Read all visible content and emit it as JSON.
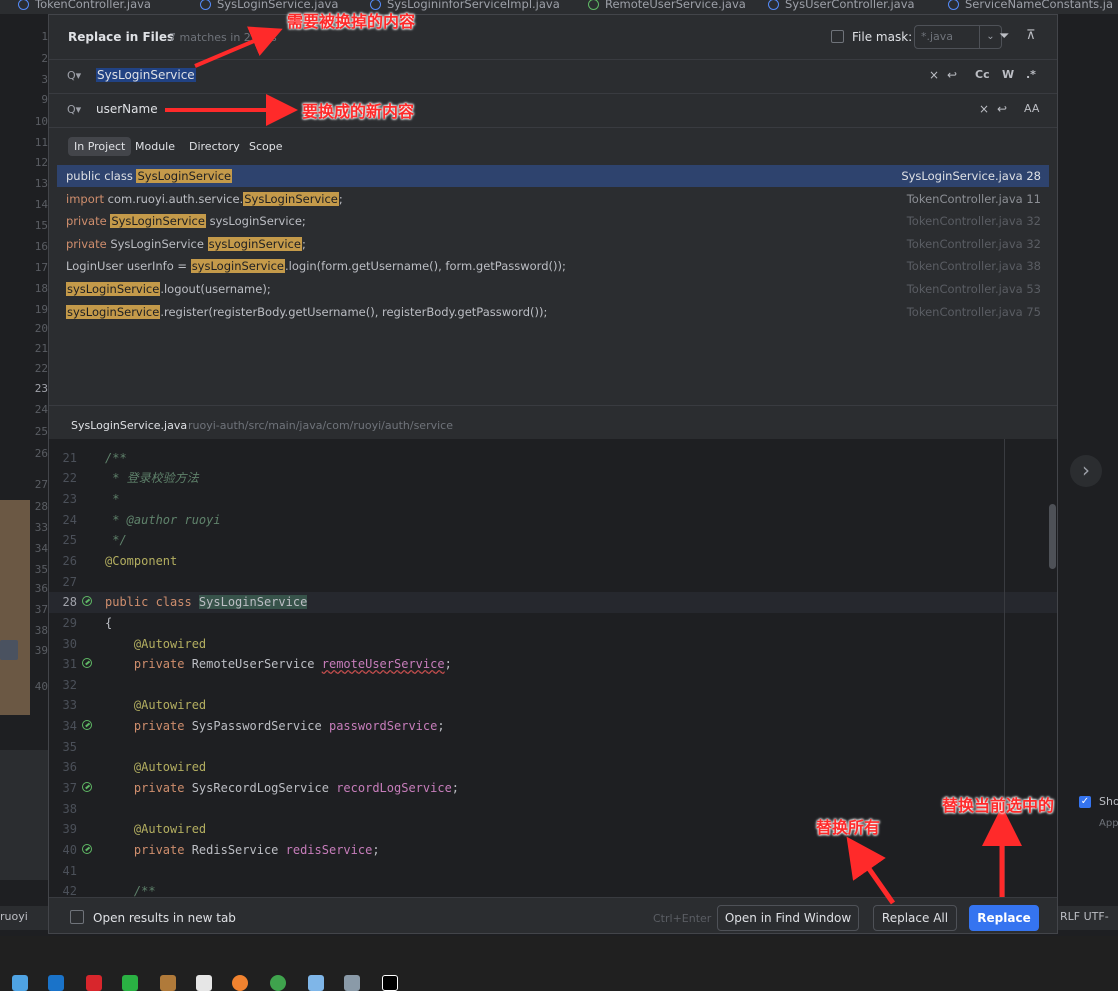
{
  "editor_tabs": [
    {
      "label": "TokenController.java",
      "icon": "class-icon"
    },
    {
      "label": "SysLoginService.java",
      "icon": "class-icon"
    },
    {
      "label": "SysLogininforServiceImpl.java",
      "icon": "class-icon"
    },
    {
      "label": "RemoteUserService.java",
      "icon": "interface-icon"
    },
    {
      "label": "SysUserController.java",
      "icon": "class-icon"
    },
    {
      "label": "ServiceNameConstants.ja",
      "icon": "class-icon"
    }
  ],
  "bg_gutter_lines": [
    "1",
    "2",
    "3",
    "9",
    "10",
    "11",
    "12",
    "13",
    "14",
    "15",
    "16",
    "17",
    "18",
    "19",
    "20",
    "21",
    "22",
    "23",
    "24",
    "25",
    "26",
    "27",
    "28",
    "33",
    "34",
    "35",
    "36",
    "37",
    "38",
    "39",
    "40"
  ],
  "dialog": {
    "title": "Replace in Files",
    "matches": "7 matches in 2 files",
    "file_mask_label": "File mask:",
    "file_mask_value": "*.java",
    "find_value": "SysLoginService",
    "find_options": [
      "Cc",
      "W",
      ".*"
    ],
    "replace_value": "userName",
    "scope_tabs": [
      "In Project",
      "Module",
      "Directory",
      "Scope"
    ],
    "active_scope": "In Project",
    "results": [
      {
        "code": [
          {
            "t": "public class ",
            "k": "kw-plain"
          },
          {
            "t": "SysLoginService",
            "k": "hl"
          }
        ],
        "file": "SysLoginService.java 28",
        "selected": true
      },
      {
        "code": [
          {
            "t": "import ",
            "k": "kw"
          },
          {
            "t": "com.ruoyi.auth.service.",
            "k": ""
          },
          {
            "t": "SysLoginService",
            "k": "hl"
          },
          {
            "t": ";",
            "k": ""
          }
        ],
        "file": "TokenController.java 11"
      },
      {
        "code": [
          {
            "t": "private ",
            "k": "kw"
          },
          {
            "t": "SysLoginService",
            "k": "hl"
          },
          {
            "t": " sysLoginService;",
            "k": ""
          }
        ],
        "file": "TokenController.java 32"
      },
      {
        "code": [
          {
            "t": "private ",
            "k": "kw"
          },
          {
            "t": "SysLoginService ",
            "k": ""
          },
          {
            "t": "sysLoginService",
            "k": "hl"
          },
          {
            "t": ";",
            "k": ""
          }
        ],
        "file": "TokenController.java 32"
      },
      {
        "code": [
          {
            "t": "LoginUser userInfo = ",
            "k": ""
          },
          {
            "t": "sysLoginService",
            "k": "hl"
          },
          {
            "t": ".login(form.getUsername(), form.getPassword());",
            "k": ""
          }
        ],
        "file": "TokenController.java 38"
      },
      {
        "code": [
          {
            "t": "sysLoginService",
            "k": "hl"
          },
          {
            "t": ".logout(username);",
            "k": ""
          }
        ],
        "file": "TokenController.java 53"
      },
      {
        "code": [
          {
            "t": "sysLoginService",
            "k": "hl"
          },
          {
            "t": ".register(registerBody.getUsername(), registerBody.getPassword());",
            "k": ""
          }
        ],
        "file": "TokenController.java 75"
      }
    ],
    "preview_file": "SysLoginService.java",
    "preview_path": "ruoyi-auth/src/main/java/com/ruoyi/auth/service",
    "code_lines": [
      {
        "n": "",
        "parts": []
      },
      {
        "n": "21",
        "parts": [
          {
            "t": "/**",
            "c": "c-doc"
          }
        ]
      },
      {
        "n": "22",
        "parts": [
          {
            "t": " * 登录校验方法",
            "c": "c-doc"
          }
        ]
      },
      {
        "n": "23",
        "parts": [
          {
            "t": " *",
            "c": "c-doc"
          }
        ]
      },
      {
        "n": "24",
        "parts": [
          {
            "t": " * @author ruoyi",
            "c": "c-doc"
          }
        ]
      },
      {
        "n": "25",
        "parts": [
          {
            "t": " */",
            "c": "c-doc"
          }
        ]
      },
      {
        "n": "26",
        "parts": [
          {
            "t": "@Component",
            "c": "c-ann"
          }
        ]
      },
      {
        "n": "27",
        "parts": []
      },
      {
        "n": "28",
        "gutter": true,
        "current": true,
        "parts": [
          {
            "t": "public class ",
            "c": "c-kw"
          },
          {
            "t": "SysLoginService",
            "c": "c-cls-hl"
          }
        ]
      },
      {
        "n": "29",
        "parts": [
          {
            "t": "{",
            "c": ""
          }
        ]
      },
      {
        "n": "30",
        "parts": [
          {
            "t": "    @Autowired",
            "c": "c-ann"
          }
        ]
      },
      {
        "n": "31",
        "gutter": true,
        "parts": [
          {
            "t": "    private ",
            "c": "c-kw"
          },
          {
            "t": "RemoteUserService ",
            "c": ""
          },
          {
            "t": "remoteUserService",
            "c": "c-fld c-wavy"
          },
          {
            "t": ";",
            "c": ""
          }
        ]
      },
      {
        "n": "32",
        "parts": []
      },
      {
        "n": "33",
        "parts": [
          {
            "t": "    @Autowired",
            "c": "c-ann"
          }
        ]
      },
      {
        "n": "34",
        "gutter": true,
        "parts": [
          {
            "t": "    private ",
            "c": "c-kw"
          },
          {
            "t": "SysPasswordService ",
            "c": ""
          },
          {
            "t": "passwordService",
            "c": "c-fld"
          },
          {
            "t": ";",
            "c": ""
          }
        ]
      },
      {
        "n": "35",
        "parts": []
      },
      {
        "n": "36",
        "parts": [
          {
            "t": "    @Autowired",
            "c": "c-ann"
          }
        ]
      },
      {
        "n": "37",
        "gutter": true,
        "parts": [
          {
            "t": "    private ",
            "c": "c-kw"
          },
          {
            "t": "SysRecordLogService ",
            "c": ""
          },
          {
            "t": "recordLogService",
            "c": "c-fld"
          },
          {
            "t": ";",
            "c": ""
          }
        ]
      },
      {
        "n": "38",
        "parts": []
      },
      {
        "n": "39",
        "parts": [
          {
            "t": "    @Autowired",
            "c": "c-ann"
          }
        ]
      },
      {
        "n": "40",
        "gutter": true,
        "parts": [
          {
            "t": "    private ",
            "c": "c-kw"
          },
          {
            "t": "RedisService ",
            "c": ""
          },
          {
            "t": "redisService",
            "c": "c-fld"
          },
          {
            "t": ";",
            "c": ""
          }
        ]
      },
      {
        "n": "41",
        "parts": []
      },
      {
        "n": "42",
        "parts": [
          {
            "t": "    /**",
            "c": "c-doc"
          }
        ]
      }
    ],
    "open_new_tab_label": "Open results in new tab",
    "shortcut_hint": "Ctrl+Enter",
    "open_find_window_label": "Open in Find Window",
    "replace_all_label": "Replace All",
    "replace_label": "Replace"
  },
  "background": {
    "show_label": "Sho",
    "app_label": "App",
    "status_left": "ruoyi",
    "status_right": "RLF  UTF-"
  },
  "annotations": {
    "find_note": "需要被换掉的内容",
    "replace_note": "要换成的新内容",
    "replace_all_note": "替换所有",
    "replace_one_note": "替换当前选中的"
  },
  "colors": {
    "accent": "#3574f0",
    "match_highlight": "#c49a4a",
    "selected_row": "#2e436e",
    "annotation": "#ff2a2a"
  }
}
